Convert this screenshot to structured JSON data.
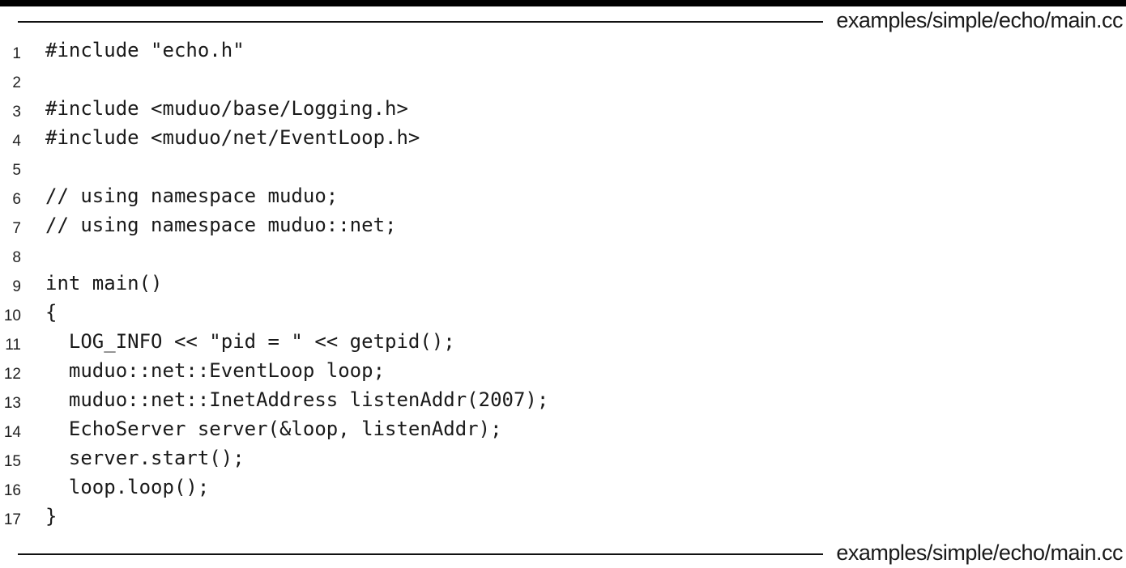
{
  "header": {
    "filename": "examples/simple/echo/main.cc"
  },
  "footer": {
    "filename": "examples/simple/echo/main.cc"
  },
  "code": {
    "lines": [
      {
        "number": "1",
        "text": "#include \"echo.h\""
      },
      {
        "number": "2",
        "text": ""
      },
      {
        "number": "3",
        "text": "#include <muduo/base/Logging.h>"
      },
      {
        "number": "4",
        "text": "#include <muduo/net/EventLoop.h>"
      },
      {
        "number": "5",
        "text": ""
      },
      {
        "number": "6",
        "text": "// using namespace muduo;"
      },
      {
        "number": "7",
        "text": "// using namespace muduo::net;"
      },
      {
        "number": "8",
        "text": ""
      },
      {
        "number": "9",
        "text": "int main()"
      },
      {
        "number": "10",
        "text": "{"
      },
      {
        "number": "11",
        "text": "  LOG_INFO << \"pid = \" << getpid();"
      },
      {
        "number": "12",
        "text": "  muduo::net::EventLoop loop;"
      },
      {
        "number": "13",
        "text": "  muduo::net::InetAddress listenAddr(2007);"
      },
      {
        "number": "14",
        "text": "  EchoServer server(&loop, listenAddr);"
      },
      {
        "number": "15",
        "text": "  server.start();"
      },
      {
        "number": "16",
        "text": "  loop.loop();"
      },
      {
        "number": "17",
        "text": "}"
      }
    ]
  }
}
